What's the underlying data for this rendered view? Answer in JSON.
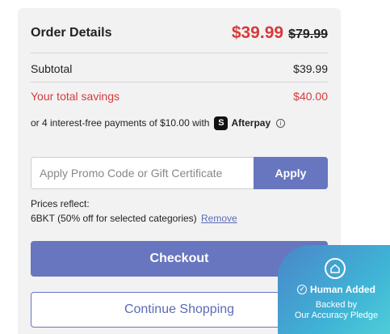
{
  "order": {
    "title": "Order Details",
    "sale_price": "$39.99",
    "original_price": "$79.99"
  },
  "summary": {
    "subtotal_label": "Subtotal",
    "subtotal_value": "$39.99",
    "savings_label": "Your total savings",
    "savings_value": "$40.00"
  },
  "afterpay": {
    "text": "or 4 interest-free payments of $10.00 with",
    "logo_glyph": "S",
    "name": "Afterpay",
    "info_glyph": "i"
  },
  "promo": {
    "placeholder": "Apply Promo Code or Gift Certificate",
    "value": "",
    "apply_label": "Apply"
  },
  "prices_reflect": {
    "label": "Prices reflect:",
    "code_text": "6BKT (50% off for selected categories)",
    "remove_label": "Remove"
  },
  "buttons": {
    "checkout_label": "Checkout",
    "continue_label": "Continue Shopping"
  },
  "badge": {
    "title": "Human Added",
    "subtitle_line1": "Backed by",
    "subtitle_line2": "Our Accuracy Pledge"
  },
  "colors": {
    "accent": "#6776bf",
    "sale": "#d63a3a",
    "badge_gradient_start": "#4a86c8",
    "badge_gradient_end": "#4fd0d8"
  }
}
